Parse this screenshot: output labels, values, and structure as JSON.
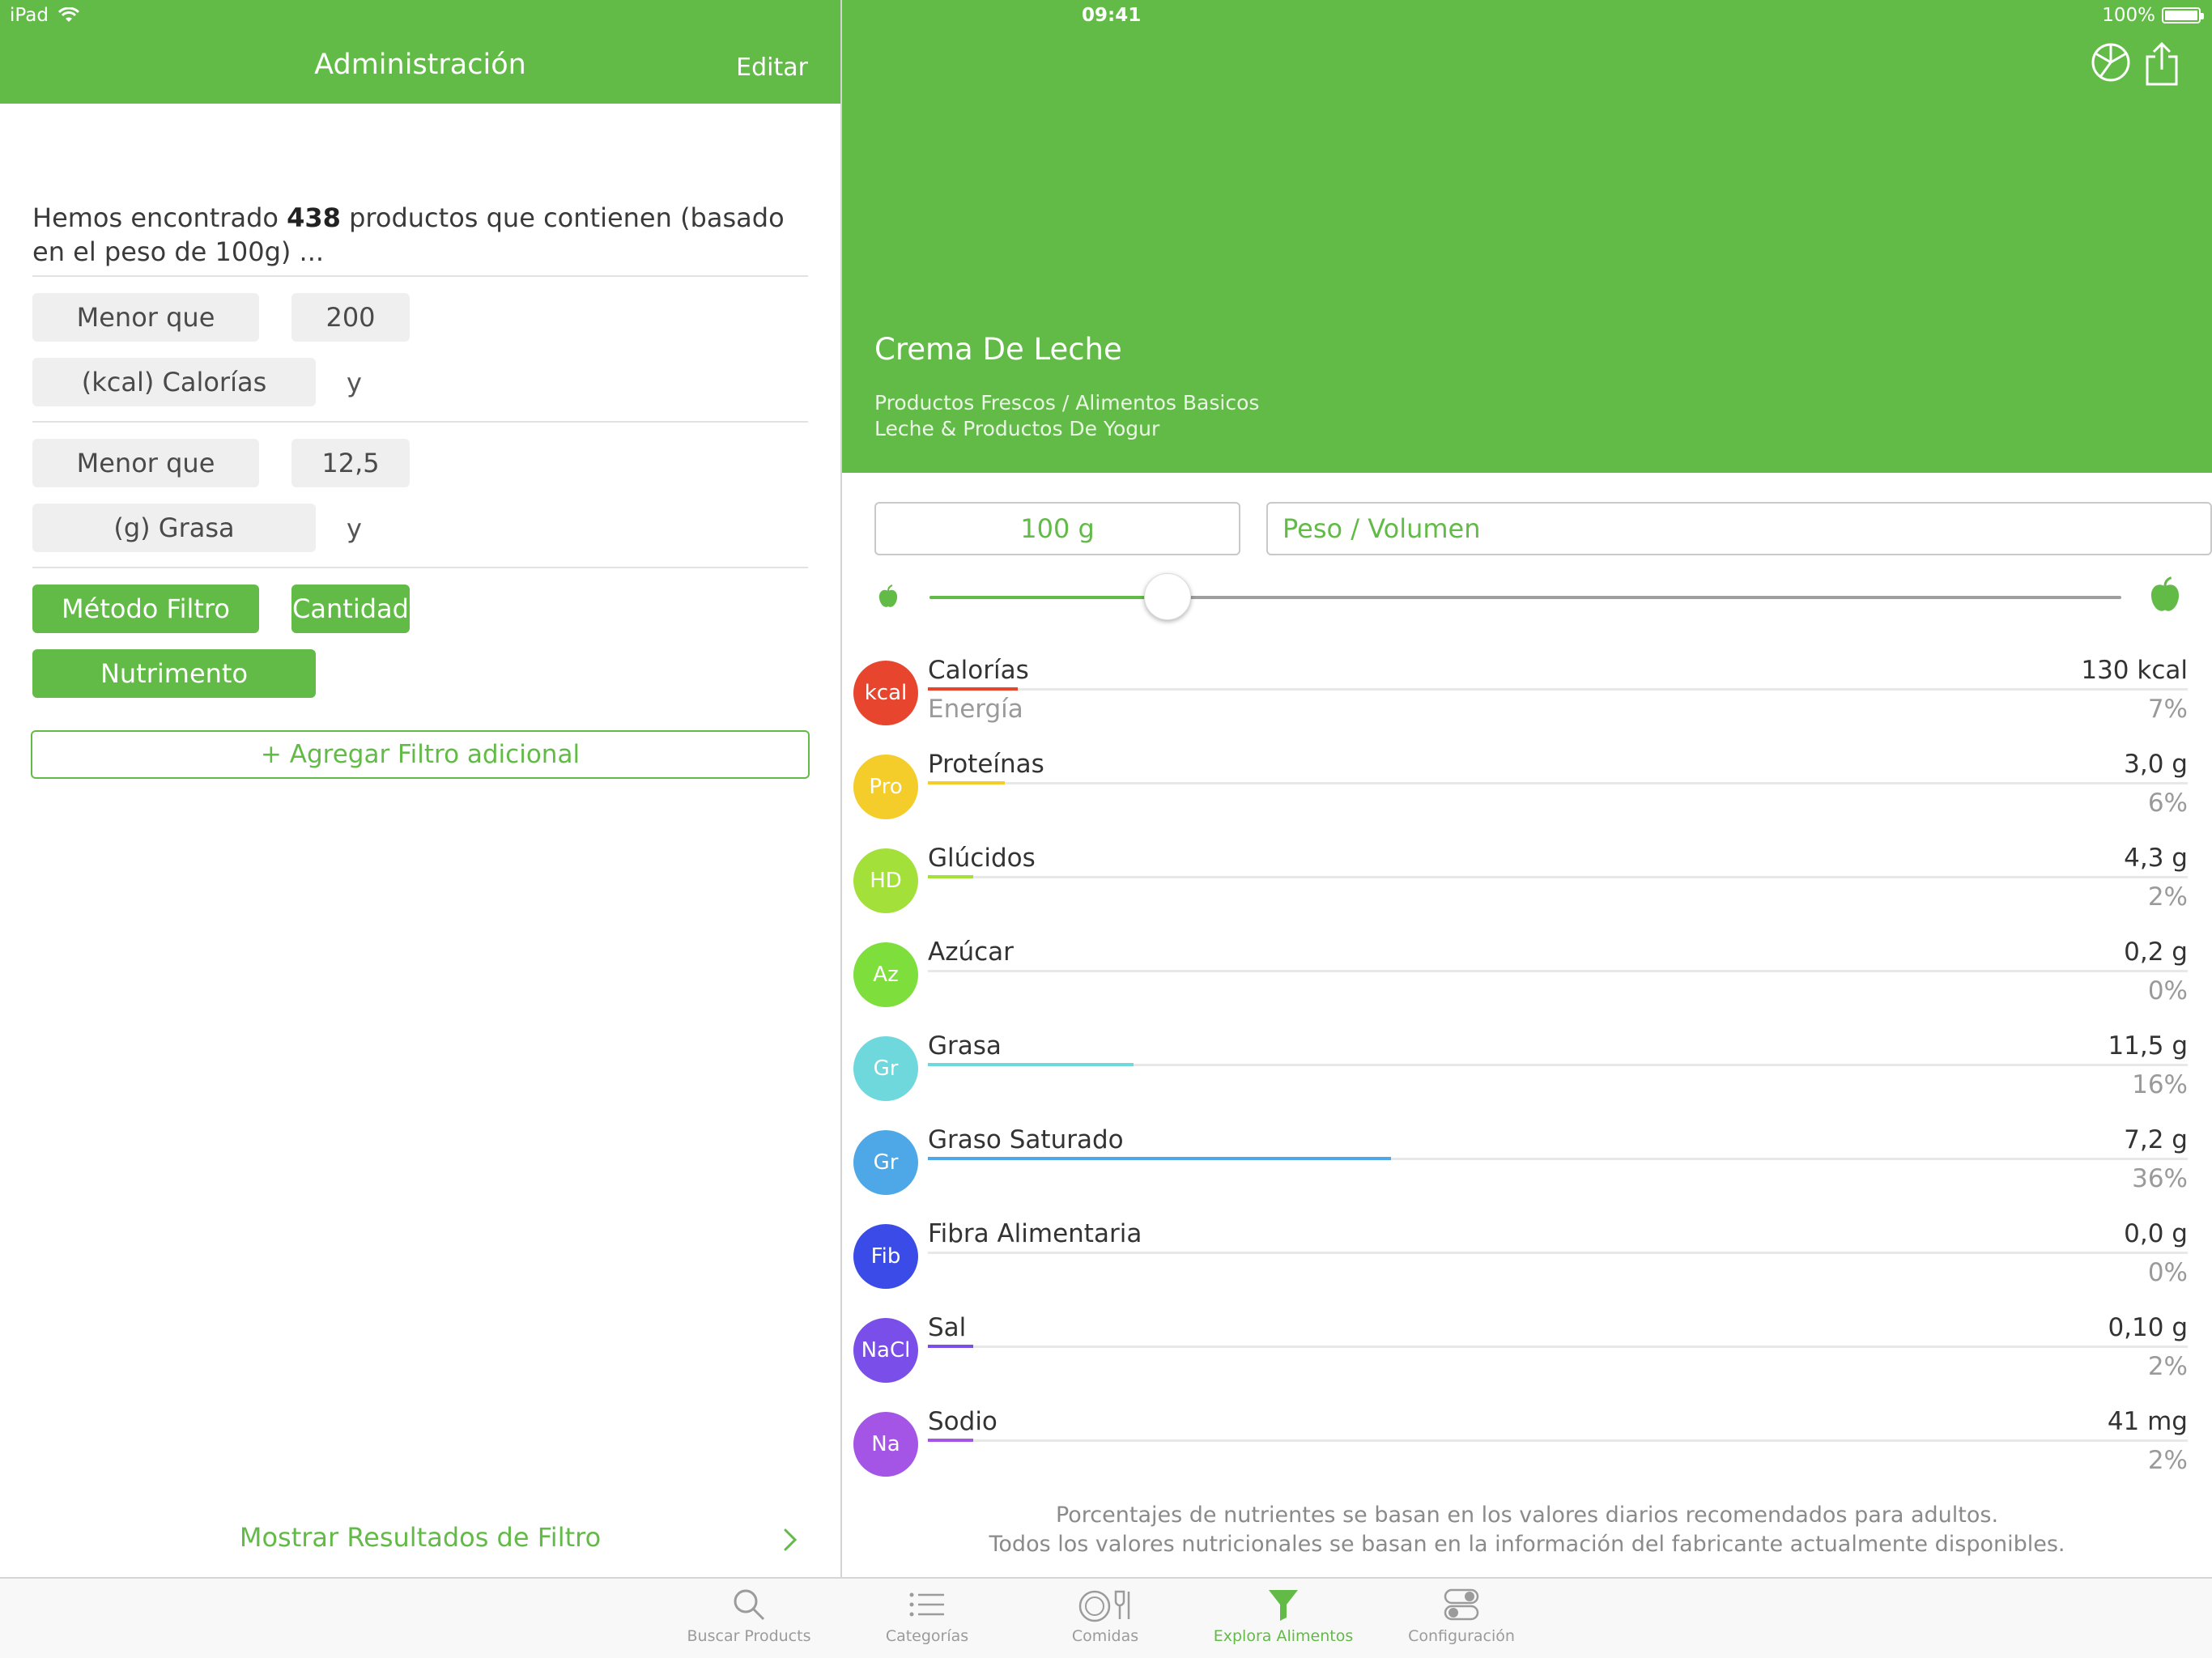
{
  "status": {
    "device": "iPad",
    "time": "09:41",
    "battery": "100%"
  },
  "master": {
    "title": "Administración",
    "edit_label": "Editar",
    "summary_prefix": "Hemos encontrado",
    "summary_count": "438",
    "summary_suffix": "productos que contienen (basado en el peso de 100g) ...",
    "filters": [
      {
        "comparator": "Menor que",
        "value": "200",
        "nutrient": "(kcal) Calorías",
        "conjunction": "y"
      },
      {
        "comparator": "Menor que",
        "value": "12,5",
        "nutrient": "(g) Grasa",
        "conjunction": "y"
      }
    ],
    "method_label": "Método Filtro",
    "quantity_label": "Cantidad",
    "nutrient_label": "Nutrimento",
    "add_filter_label": "+ Agregar Filtro adicional",
    "show_results_label": "Mostrar Resultados de Filtro"
  },
  "detail": {
    "product_name": "Crema De Leche",
    "category_line1": "Productos Frescos / Alimentos Basicos",
    "category_line2": "Leche & Productos De Yogur",
    "quantity_value": "100 g",
    "unit_placeholder": "Peso / Volumen",
    "slider_fraction": 0.2,
    "nutrients": [
      {
        "badge": "kcal",
        "name": "Calorías",
        "sub": "Energía",
        "amount": "130 kcal",
        "percent": "7%",
        "fraction": 0.07,
        "color": "#e8452f"
      },
      {
        "badge": "Pro",
        "name": "Proteínas",
        "sub": "",
        "amount": "3,0 g",
        "percent": "6%",
        "fraction": 0.06,
        "color": "#f4cd2a"
      },
      {
        "badge": "HD",
        "name": "Glúcidos",
        "sub": "",
        "amount": "4,3 g",
        "percent": "2%",
        "fraction": 0.02,
        "color": "#a4e03a"
      },
      {
        "badge": "Az",
        "name": "Azúcar",
        "sub": "",
        "amount": "0,2 g",
        "percent": "0%",
        "fraction": 0.0,
        "color": "#7ede3c"
      },
      {
        "badge": "Gr",
        "name": "Grasa",
        "sub": "",
        "amount": "11,5 g",
        "percent": "16%",
        "fraction": 0.16,
        "color": "#6fd8dc"
      },
      {
        "badge": "Gr",
        "name": "Graso Saturado",
        "sub": "",
        "amount": "7,2 g",
        "percent": "36%",
        "fraction": 0.36,
        "color": "#4ea8e8"
      },
      {
        "badge": "Fib",
        "name": "Fibra Alimentaria",
        "sub": "",
        "amount": "0,0 g",
        "percent": "0%",
        "fraction": 0.0,
        "color": "#3b4be8"
      },
      {
        "badge": "NaCl",
        "name": "Sal",
        "sub": "",
        "amount": "0,10 g",
        "percent": "2%",
        "fraction": 0.02,
        "color": "#7a4ee8"
      },
      {
        "badge": "Na",
        "name": "Sodio",
        "sub": "",
        "amount": "41 mg",
        "percent": "2%",
        "fraction": 0.02,
        "color": "#a455e6"
      }
    ],
    "footnote_line1": "Porcentajes de nutrientes se basan en los valores diarios recomendados para adultos.",
    "footnote_line2": "Todos los valores nutricionales se basan en la información del fabricante actualmente disponibles."
  },
  "tabs": [
    {
      "label": "Buscar Products",
      "icon": "search-icon",
      "active": false
    },
    {
      "label": "Categorías",
      "icon": "list-icon",
      "active": false
    },
    {
      "label": "Comidas",
      "icon": "plate-icon",
      "active": false
    },
    {
      "label": "Explora Alimentos",
      "icon": "filter-icon",
      "active": true
    },
    {
      "label": "Configuración",
      "icon": "toggles-icon",
      "active": false
    }
  ],
  "colors": {
    "brand_green": "#62bb47",
    "tab_inactive": "#9b9b9b"
  }
}
